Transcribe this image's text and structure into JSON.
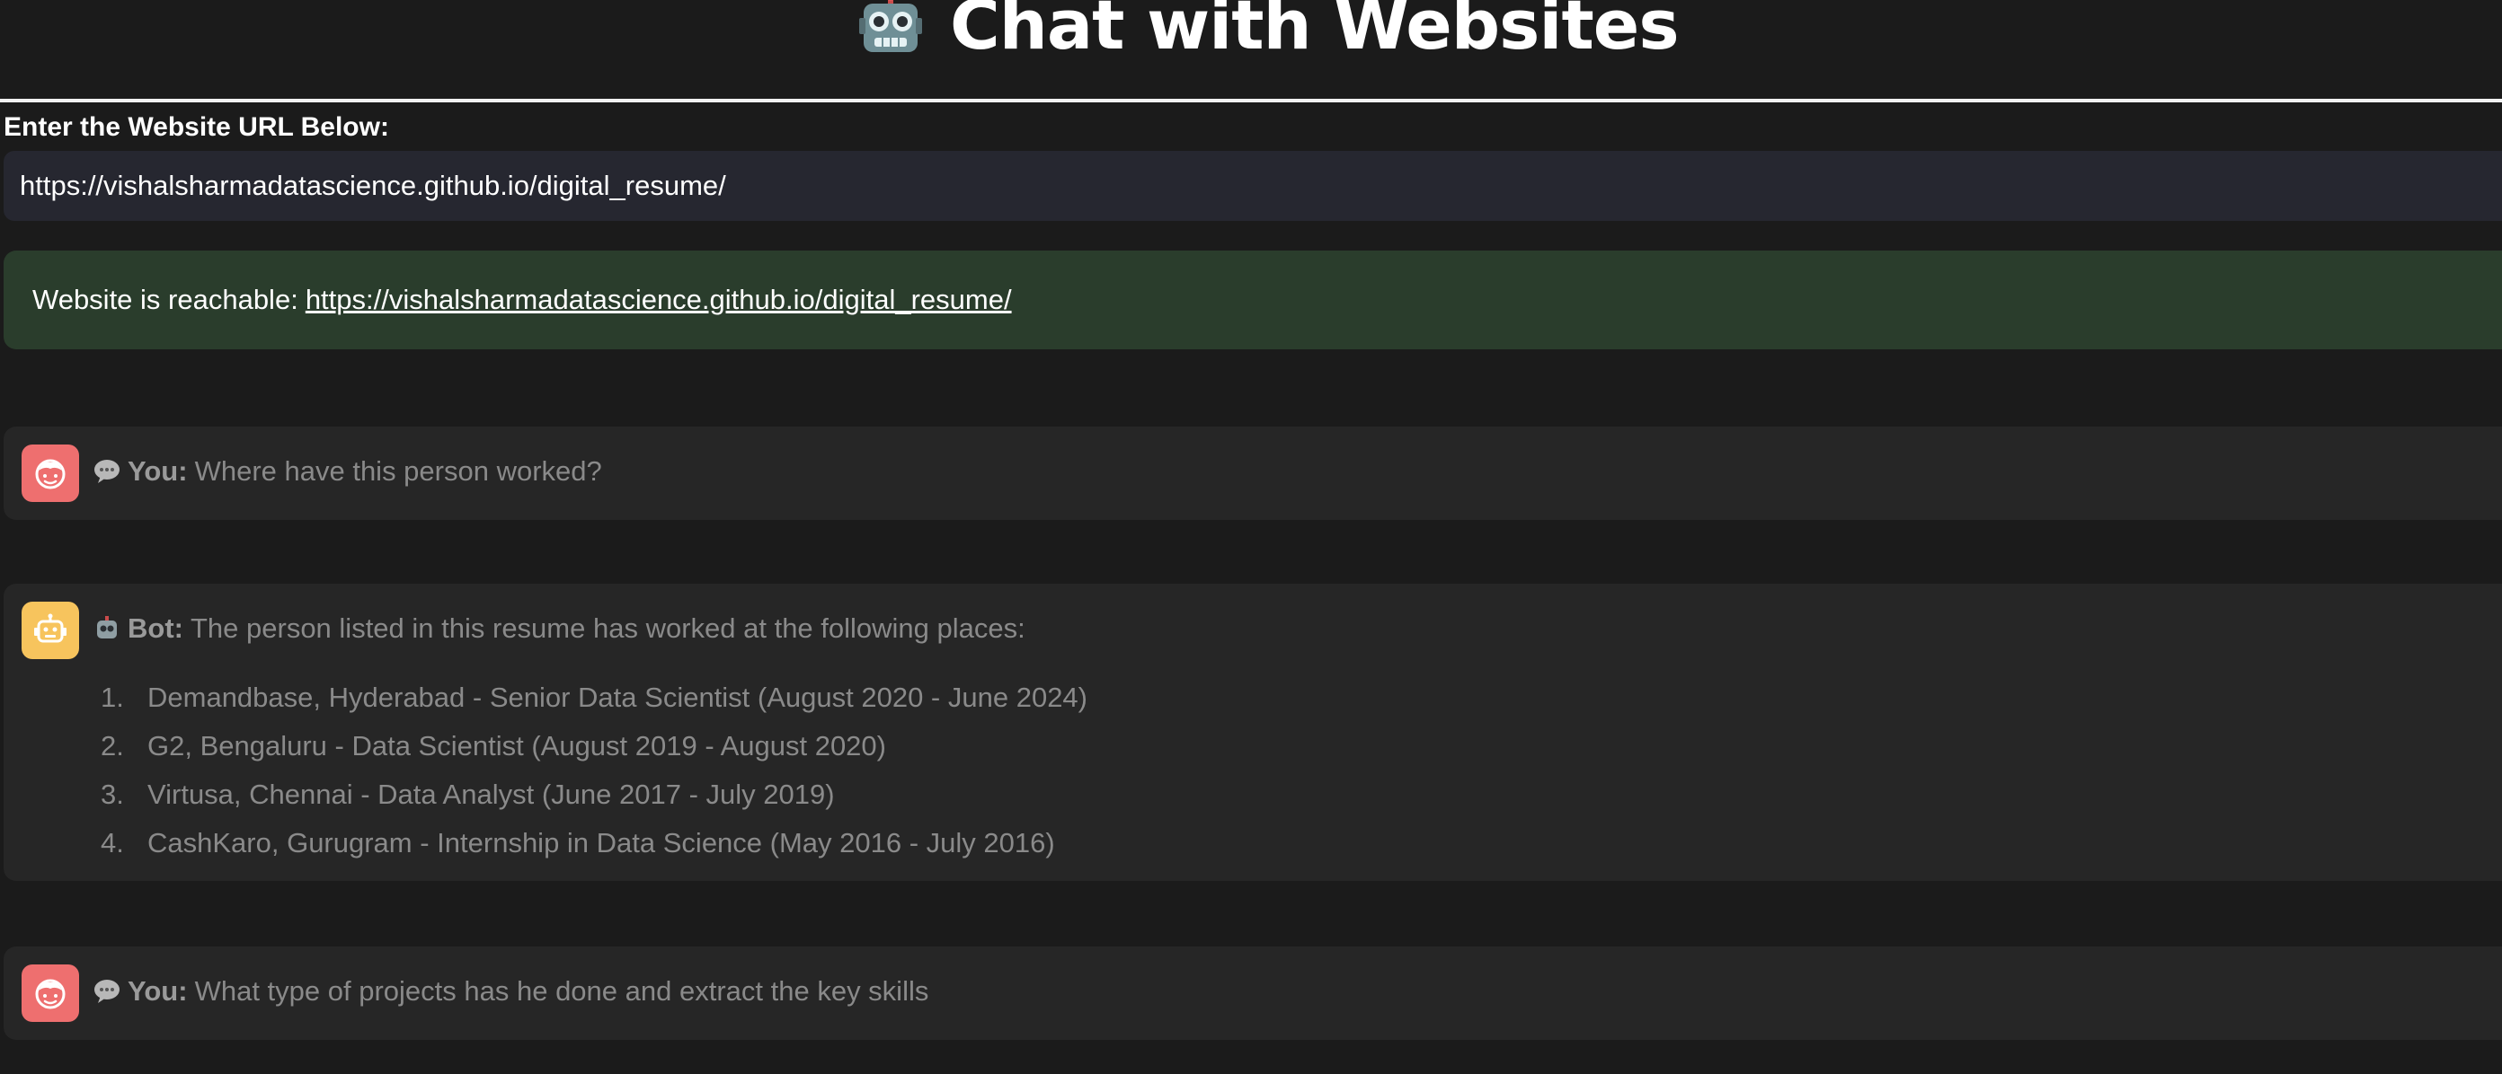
{
  "header": {
    "title": "Chat with Websites",
    "title_icon": "robot-icon"
  },
  "url_section": {
    "label": "Enter the Website URL Below:",
    "input_value": "https://vishalsharmadatascience.github.io/digital_resume/"
  },
  "status": {
    "prefix": "Website is reachable:",
    "link": "https://vishalsharmadatascience.github.io/digital_resume/",
    "color": "#2a3d2c"
  },
  "chat": {
    "messages": [
      {
        "role": "user",
        "speaker": "You:",
        "text": "Where have this person worked?",
        "avatar_icon": "user-face-icon",
        "avatar_color": "#ee6f6f"
      },
      {
        "role": "bot",
        "speaker": "Bot:",
        "text": "The person listed in this resume has worked at the following places:",
        "avatar_icon": "bot-face-icon",
        "avatar_color": "#f7c45d",
        "list": [
          {
            "num": "1.",
            "text": "Demandbase, Hyderabad - Senior Data Scientist (August 2020 - June 2024)"
          },
          {
            "num": "2.",
            "text": "G2, Bengaluru - Data Scientist (August 2019 - August 2020)"
          },
          {
            "num": "3.",
            "text": "Virtusa, Chennai - Data Analyst (June 2017 - July 2019)"
          },
          {
            "num": "4.",
            "text": "CashKaro, Gurugram - Internship in Data Science (May 2016 - July 2016)"
          }
        ]
      },
      {
        "role": "user",
        "speaker": "You:",
        "text": "What type of projects has he done and extract the key skills",
        "avatar_icon": "user-face-icon",
        "avatar_color": "#ee6f6f"
      }
    ]
  }
}
